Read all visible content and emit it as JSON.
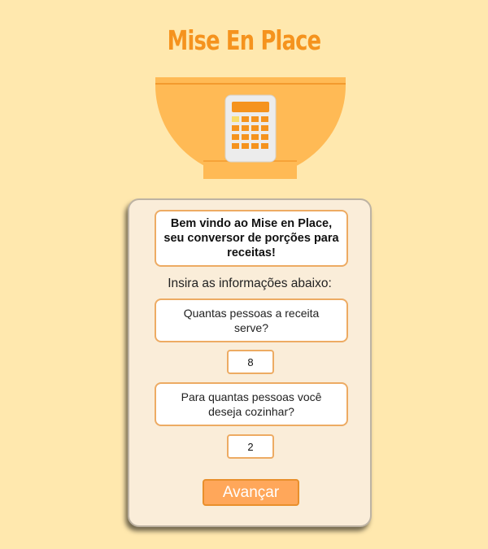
{
  "app": {
    "title": "Mise En Place",
    "logo_icon": "bowl-calculator-icon"
  },
  "colors": {
    "background": "#FFE8AE",
    "accent": "#F5931E",
    "bowl": "#FFBA55",
    "card": "#FAEDD9",
    "field_border": "#EDAB63",
    "button": "#FFA75A"
  },
  "form": {
    "welcome": "Bem vindo ao Mise en Place, seu conversor de porções para receitas!",
    "instructions": "Insira as informações abaixo:",
    "servings_question": "Quantas pessoas a receita serve?",
    "servings_value": "8",
    "target_question": "Para quantas pessoas você deseja cozinhar?",
    "target_value": "2",
    "submit_label": "Avançar"
  }
}
